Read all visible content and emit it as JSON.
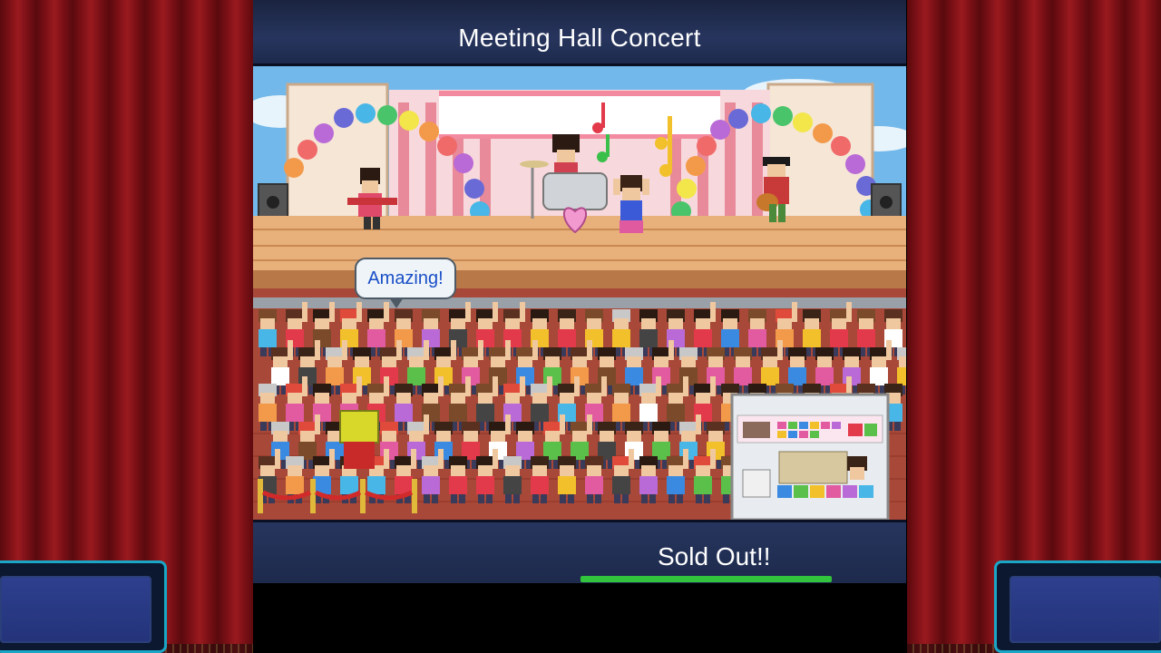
{
  "window": {
    "title": "Meeting Hall Concert"
  },
  "scene": {
    "speech_bubble": "Amazing!",
    "performers": [
      "guitarist",
      "drummer",
      "singer",
      "acoustic-guitarist"
    ],
    "has_merch_booth": true
  },
  "status": {
    "label": "Sold Out!!",
    "progress": 1.0,
    "progress_color": "#33c43d"
  },
  "colors": {
    "curtain": "#7a1016",
    "title_bar": "#27355e",
    "panel_border": "#1aa6c6",
    "bubble_text": "#1a4fc7"
  }
}
